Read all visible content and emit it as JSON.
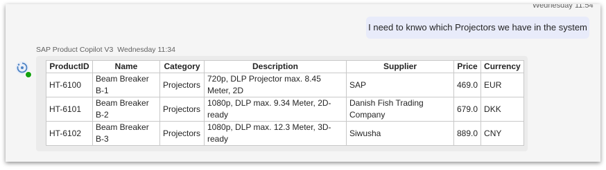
{
  "header": {
    "cutoff_time": "Wednesday 11:54"
  },
  "user_message": {
    "text": "I need to knwo which Projectors we have in the system"
  },
  "bot": {
    "name": "SAP Product Copilot V3",
    "timestamp": "Wednesday 11:34",
    "avatar_icon": "copilot-avatar-icon",
    "status_color": "#13a10e"
  },
  "table": {
    "headers": [
      "ProductID",
      "Name",
      "Category",
      "Description",
      "Supplier",
      "Price",
      "Currency"
    ],
    "rows": [
      [
        "HT-6100",
        "Beam Breaker B-1",
        "Projectors",
        "720p, DLP Projector max. 8.45 Meter, 2D",
        "SAP",
        "469.0",
        "EUR"
      ],
      [
        "HT-6101",
        "Beam Breaker B-2",
        "Projectors",
        "1080p, DLP max. 9.34 Meter, 2D-ready",
        "Danish Fish Trading Company",
        "679.0",
        "DKK"
      ],
      [
        "HT-6102",
        "Beam Breaker B-3",
        "Projectors",
        "1080p, DLP max. 12.3 Meter, 3D-ready",
        "Siwusha",
        "889.0",
        "CNY"
      ]
    ]
  }
}
